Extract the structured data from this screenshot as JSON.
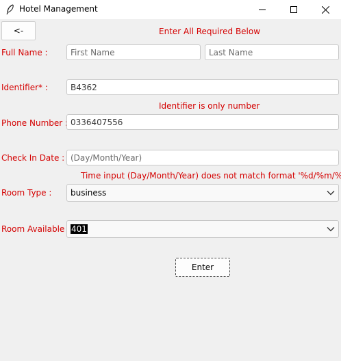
{
  "window": {
    "title": "Hotel Management",
    "icon": "feather-icon",
    "controls": [
      "minimize-icon",
      "maximize-icon",
      "close-icon"
    ]
  },
  "back_button": {
    "label": "<-"
  },
  "header_message": "Enter All Required Below",
  "full_name": {
    "label": "Full Name :",
    "first_placeholder": "First Name",
    "last_placeholder": "Last Name"
  },
  "identifier": {
    "label": "Identifier* :",
    "value": "B4362",
    "error": "Identifier is only number"
  },
  "phone": {
    "label": "Phone Number :",
    "value": "0336407556"
  },
  "check_in": {
    "label": "Check In Date :",
    "placeholder": "(Day/Month/Year)",
    "error": "Time input (Day/Month/Year) does not match format '%d/%m/%Y'"
  },
  "room_type": {
    "label": "Room Type :",
    "selected": "business"
  },
  "room_available": {
    "label": "Room Available :",
    "selected": "401"
  },
  "enter_button": {
    "label": "Enter"
  },
  "colors": {
    "error_red": "#d40000",
    "background": "#f0f0f0",
    "entry_border": "#c8c8c8"
  }
}
